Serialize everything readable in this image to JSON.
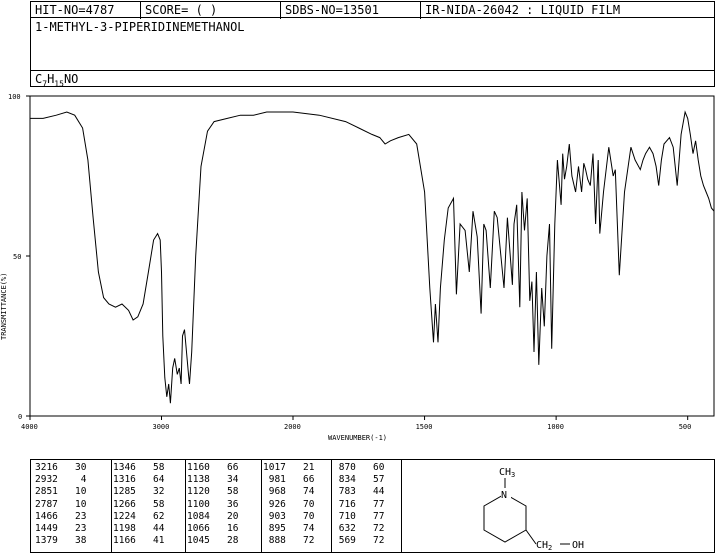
{
  "header": {
    "hit_no": "HIT-NO=4787",
    "score": "SCORE=  (   )",
    "sdbs_no": "SDBS-NO=13501",
    "ir_code": "IR-NIDA-26042 : LIQUID FILM"
  },
  "compound_name": "1-METHYL-3-PIPERIDINEMETHANOL",
  "formula": {
    "c": "C",
    "c_sub": "7",
    "h": "H",
    "h_sub": "15",
    "rest": "NO"
  },
  "chart_data": {
    "type": "line",
    "xlabel": "WAVENUMBER(-1)",
    "ylabel": "TRANSMITTANCE(%)",
    "xlim": [
      4000,
      400
    ],
    "ylim": [
      0,
      100
    ],
    "x_ticks": [
      "4000",
      "3000",
      "2000",
      "1500",
      "1000",
      "500"
    ],
    "y_ticks": [
      "100",
      "50",
      "0"
    ],
    "x": [
      4000,
      3900,
      3800,
      3720,
      3660,
      3600,
      3560,
      3520,
      3480,
      3440,
      3400,
      3350,
      3300,
      3250,
      3216,
      3180,
      3140,
      3100,
      3060,
      3030,
      3010,
      3000,
      2990,
      2975,
      2960,
      2945,
      2932,
      2915,
      2900,
      2880,
      2865,
      2851,
      2840,
      2825,
      2810,
      2795,
      2787,
      2770,
      2740,
      2700,
      2650,
      2600,
      2500,
      2400,
      2300,
      2200,
      2100,
      2000,
      1900,
      1800,
      1750,
      1700,
      1670,
      1650,
      1630,
      1600,
      1560,
      1530,
      1500,
      1480,
      1466,
      1459,
      1449,
      1440,
      1425,
      1410,
      1390,
      1379,
      1365,
      1346,
      1330,
      1316,
      1300,
      1285,
      1275,
      1266,
      1250,
      1235,
      1224,
      1210,
      1198,
      1185,
      1166,
      1160,
      1150,
      1138,
      1130,
      1120,
      1110,
      1100,
      1092,
      1084,
      1075,
      1066,
      1055,
      1045,
      1035,
      1025,
      1017,
      1005,
      995,
      981,
      975,
      968,
      960,
      950,
      940,
      926,
      915,
      903,
      895,
      888,
      880,
      870,
      860,
      850,
      840,
      834,
      820,
      800,
      783,
      775,
      760,
      740,
      716,
      700,
      680,
      670,
      660,
      645,
      632,
      620,
      610,
      600,
      590,
      569,
      555,
      540,
      525,
      510,
      500,
      490,
      480,
      470,
      460,
      450,
      440,
      430,
      420,
      410,
      400
    ],
    "y": [
      93,
      93,
      94,
      95,
      94,
      90,
      80,
      62,
      45,
      37,
      35,
      34,
      35,
      33,
      30,
      31,
      35,
      45,
      55,
      57,
      55,
      45,
      25,
      12,
      6,
      10,
      4,
      15,
      18,
      13,
      15,
      10,
      25,
      27,
      20,
      13,
      10,
      20,
      50,
      78,
      89,
      92,
      93,
      94,
      94,
      95,
      95,
      95,
      94,
      92,
      90,
      88,
      87,
      85,
      86,
      87,
      88,
      85,
      70,
      40,
      23,
      35,
      23,
      40,
      55,
      65,
      68,
      38,
      60,
      58,
      45,
      64,
      56,
      32,
      60,
      58,
      40,
      64,
      62,
      50,
      40,
      62,
      41,
      60,
      66,
      34,
      70,
      58,
      68,
      36,
      42,
      20,
      45,
      16,
      40,
      28,
      50,
      60,
      21,
      60,
      80,
      66,
      82,
      74,
      78,
      85,
      75,
      70,
      78,
      70,
      79,
      77,
      74,
      72,
      82,
      60,
      80,
      57,
      70,
      84,
      75,
      77,
      44,
      70,
      84,
      80,
      77,
      80,
      82,
      84,
      82,
      78,
      72,
      80,
      85,
      87,
      84,
      72,
      88,
      95,
      93,
      88,
      82,
      86,
      80,
      75,
      72,
      70,
      68,
      65,
      64,
      62
    ]
  },
  "peak_table": {
    "columns": [
      [
        [
          "3216",
          "30"
        ],
        [
          "2932",
          "4"
        ],
        [
          "2851",
          "10"
        ],
        [
          "2787",
          "10"
        ],
        [
          "1466",
          "23"
        ],
        [
          "1449",
          "23"
        ],
        [
          "1379",
          "38"
        ]
      ],
      [
        [
          "1346",
          "58"
        ],
        [
          "1316",
          "64"
        ],
        [
          "1285",
          "32"
        ],
        [
          "1266",
          "58"
        ],
        [
          "1224",
          "62"
        ],
        [
          "1198",
          "44"
        ],
        [
          "1166",
          "41"
        ]
      ],
      [
        [
          "1160",
          "66"
        ],
        [
          "1138",
          "34"
        ],
        [
          "1120",
          "58"
        ],
        [
          "1100",
          "36"
        ],
        [
          "1084",
          "20"
        ],
        [
          "1066",
          "16"
        ],
        [
          "1045",
          "28"
        ]
      ],
      [
        [
          "1017",
          "21"
        ],
        [
          "981",
          "66"
        ],
        [
          "968",
          "74"
        ],
        [
          "926",
          "70"
        ],
        [
          "903",
          "70"
        ],
        [
          "895",
          "74"
        ],
        [
          "888",
          "72"
        ]
      ],
      [
        [
          "870",
          "60"
        ],
        [
          "834",
          "57"
        ],
        [
          "783",
          "44"
        ],
        [
          "716",
          "77"
        ],
        [
          "710",
          "77"
        ],
        [
          "632",
          "72"
        ],
        [
          "569",
          "72"
        ]
      ]
    ]
  },
  "structure": {
    "methyl_label": "CH",
    "methyl_sub": "3",
    "nitrogen_label": "N",
    "ch2_label": "CH",
    "ch2_sub": "2",
    "oh_label": "OH"
  }
}
